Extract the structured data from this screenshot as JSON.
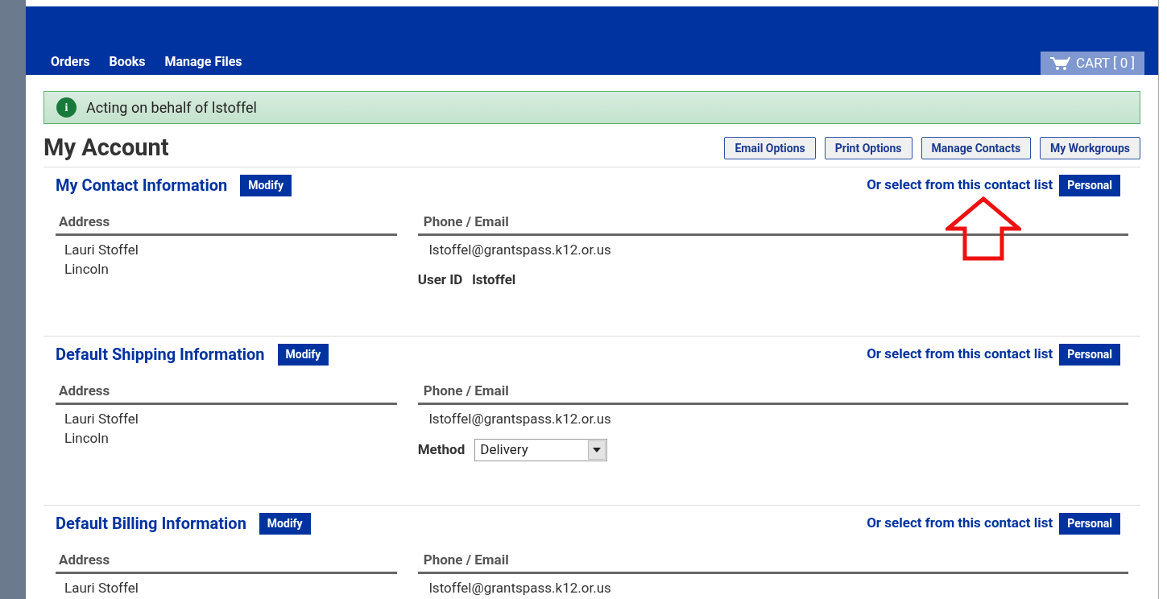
{
  "nav": {
    "items": [
      {
        "label": "Orders"
      },
      {
        "label": "Books"
      },
      {
        "label": "Manage Files"
      }
    ],
    "cart": "CART [ 0 ]"
  },
  "notice": {
    "icon": "i",
    "text": "Acting on behalf of lstoffel"
  },
  "page_title": "My Account",
  "actions": [
    "Email Options",
    "Print Options",
    "Manage Contacts",
    "My Workgroups"
  ],
  "sections": [
    {
      "title": "My Contact Information",
      "modify": "Modify",
      "contact_list_label": "Or select from this contact list",
      "contact_list_button": "Personal",
      "address_heading": "Address",
      "address_lines": [
        "Lauri Stoffel",
        "Lincoln"
      ],
      "phone_heading": "Phone / Email",
      "email": "lstoffel@grantspass.k12.or.us",
      "extra": {
        "kind": "user_id",
        "label": "User ID",
        "value": "lstoffel"
      }
    },
    {
      "title": "Default Shipping Information",
      "modify": "Modify",
      "contact_list_label": "Or select from this contact list",
      "contact_list_button": "Personal",
      "address_heading": "Address",
      "address_lines": [
        "Lauri Stoffel",
        "Lincoln"
      ],
      "phone_heading": "Phone / Email",
      "email": "lstoffel@grantspass.k12.or.us",
      "extra": {
        "kind": "method",
        "label": "Method",
        "value": "Delivery"
      }
    },
    {
      "title": "Default Billing Information",
      "modify": "Modify",
      "contact_list_label": "Or select from this contact list",
      "contact_list_button": "Personal",
      "address_heading": "Address",
      "address_lines": [
        "Lauri Stoffel"
      ],
      "phone_heading": "Phone / Email",
      "email": "lstoffel@grantspass.k12.or.us"
    }
  ]
}
